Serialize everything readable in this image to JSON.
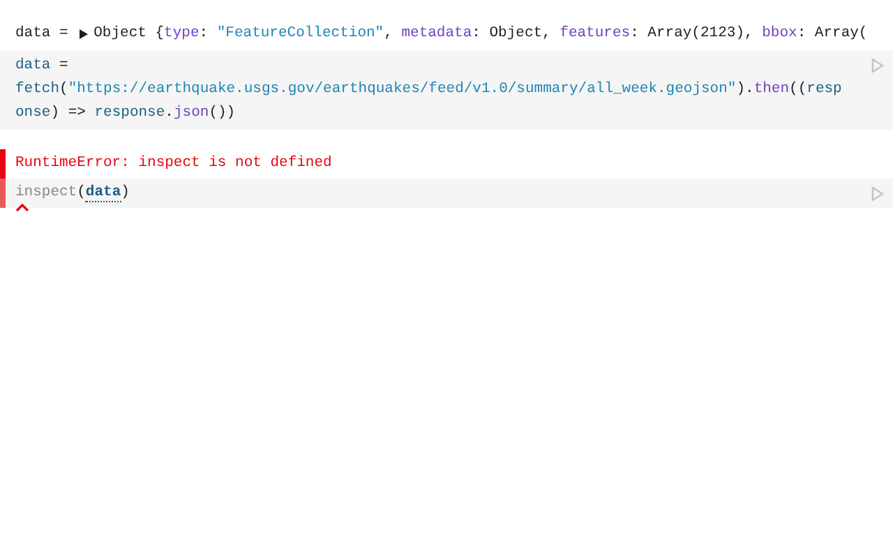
{
  "output": {
    "name": "data =",
    "expanded": false,
    "tokens": [
      {
        "kind": "plain",
        "text": "Object {"
      },
      {
        "kind": "key",
        "text": "type"
      },
      {
        "kind": "plain",
        "text": ": "
      },
      {
        "kind": "string",
        "text": "\"FeatureCollection\""
      },
      {
        "kind": "plain",
        "text": ", "
      },
      {
        "kind": "key",
        "text": "metadata"
      },
      {
        "kind": "plain",
        "text": ": Object, "
      },
      {
        "kind": "key",
        "text": "features"
      },
      {
        "kind": "plain",
        "text": ": Array(2123), "
      },
      {
        "kind": "key",
        "text": "bbox"
      },
      {
        "kind": "plain",
        "text": ": Array("
      }
    ]
  },
  "cells": [
    {
      "error": false,
      "tokens": [
        {
          "kind": "var",
          "text": "data"
        },
        {
          "kind": "plain",
          "text": " ="
        },
        {
          "kind": "break"
        },
        {
          "kind": "var",
          "text": "fetch"
        },
        {
          "kind": "plain",
          "text": "("
        },
        {
          "kind": "string",
          "text": "\"https://earthquake.usgs.gov/earthquakes/feed/v1.0/summary/all_week.geojson\""
        },
        {
          "kind": "plain",
          "text": ")."
        },
        {
          "kind": "key",
          "text": "then"
        },
        {
          "kind": "plain",
          "text": "(("
        },
        {
          "kind": "var",
          "text": "response"
        },
        {
          "kind": "plain",
          "text": ") => "
        },
        {
          "kind": "var",
          "text": "response"
        },
        {
          "kind": "plain",
          "text": "."
        },
        {
          "kind": "key",
          "text": "json"
        },
        {
          "kind": "plain",
          "text": "())"
        }
      ]
    },
    {
      "error": true,
      "message": "RuntimeError: inspect is not defined",
      "tokens": [
        {
          "kind": "undefined",
          "text": "inspect"
        },
        {
          "kind": "plain",
          "text": "("
        },
        {
          "kind": "ref",
          "text": "data"
        },
        {
          "kind": "plain",
          "text": ")"
        }
      ]
    }
  ]
}
